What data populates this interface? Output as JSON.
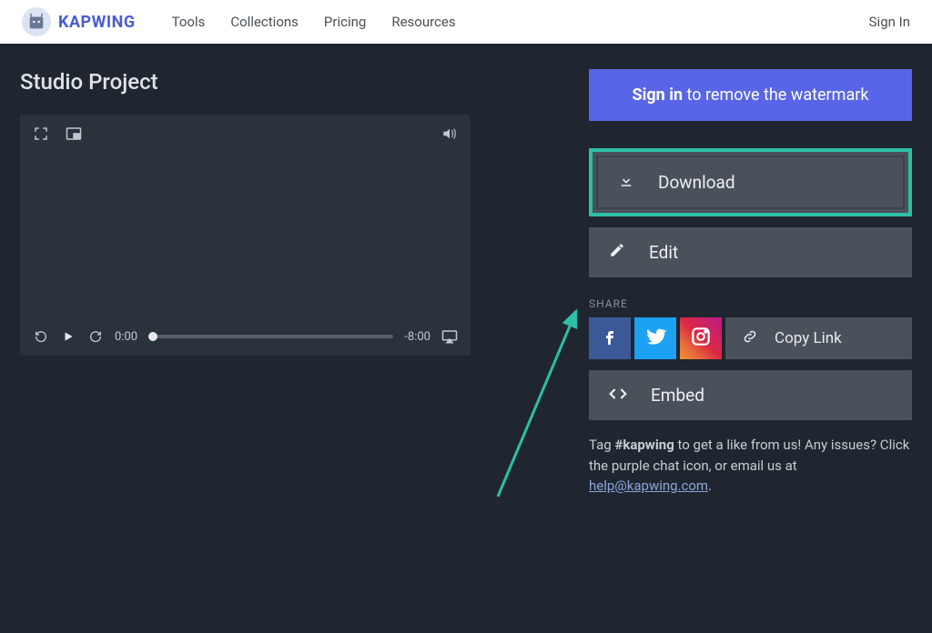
{
  "brand": "KAPWING",
  "nav": {
    "tools": "Tools",
    "collections": "Collections",
    "pricing": "Pricing",
    "resources": "Resources"
  },
  "signin_header": "Sign In",
  "page_title": "Studio Project",
  "player": {
    "current_time": "0:00",
    "remaining": "-8:00"
  },
  "banner": {
    "strong": "Sign in",
    "rest": " to remove the watermark"
  },
  "actions": {
    "download": "Download",
    "edit": "Edit",
    "copy_link": "Copy Link",
    "embed": "Embed"
  },
  "share_label": "SHARE",
  "footer": {
    "pre": "Tag ",
    "hashtag": "#kapwing",
    "mid": " to get a like from us! Any issues? Click the purple chat icon, or email us at ",
    "email": "help@kapwing.com",
    "post": "."
  }
}
